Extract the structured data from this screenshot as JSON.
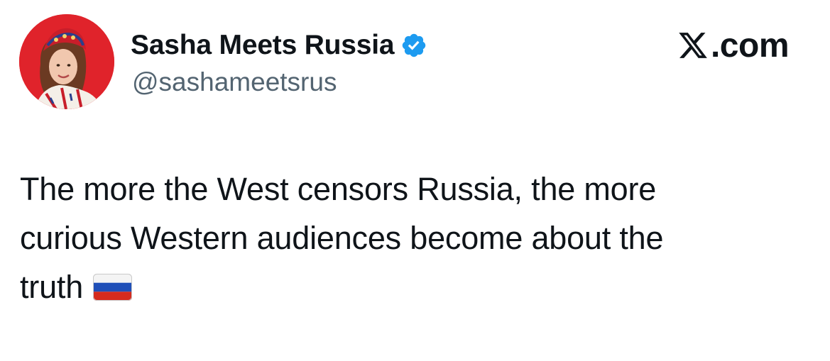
{
  "author": {
    "display_name": "Sasha Meets Russia",
    "handle": "@sashameetsrus",
    "verified": true,
    "avatar_icon": "profile-photo-woman-in-kokoshnik"
  },
  "brand": {
    "logo_icon": "x-logo-icon",
    "text": ".com"
  },
  "tweet": {
    "lines": [
      "The more the West censors Russia, the more",
      "curious Western audiences become about the",
      "truth"
    ],
    "emoji": "russia-flag"
  },
  "colors": {
    "text_primary": "#0f1419",
    "text_secondary": "#536471",
    "verified_blue": "#1d9bf0",
    "avatar_bg": "#e0232b"
  }
}
